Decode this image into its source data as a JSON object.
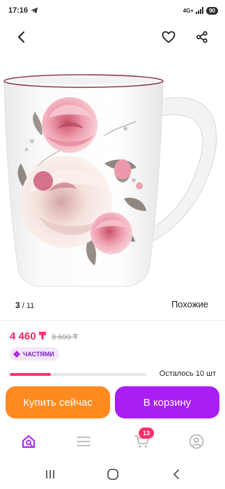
{
  "status": {
    "time": "17:16",
    "network": "4G+",
    "battery": "90"
  },
  "gallery": {
    "current": "3",
    "total": "/ 11",
    "similar_label": "Похожие"
  },
  "price": {
    "current": "4 460 ₸",
    "old": "8 690 ₸"
  },
  "installment": {
    "label": "ЧАСТЯМИ"
  },
  "stock": {
    "text": "Осталось 10 шт",
    "remaining_fraction": 0.3
  },
  "actions": {
    "buy_now": "Купить сейчас",
    "add_to_cart": "В корзину"
  },
  "nav": {
    "cart_count": "13"
  },
  "colors": {
    "price": "#ff1f5e",
    "buy_now": "#ff8a1f",
    "add_to_cart": "#a81ef5",
    "installment_text": "#7b1fc0"
  }
}
